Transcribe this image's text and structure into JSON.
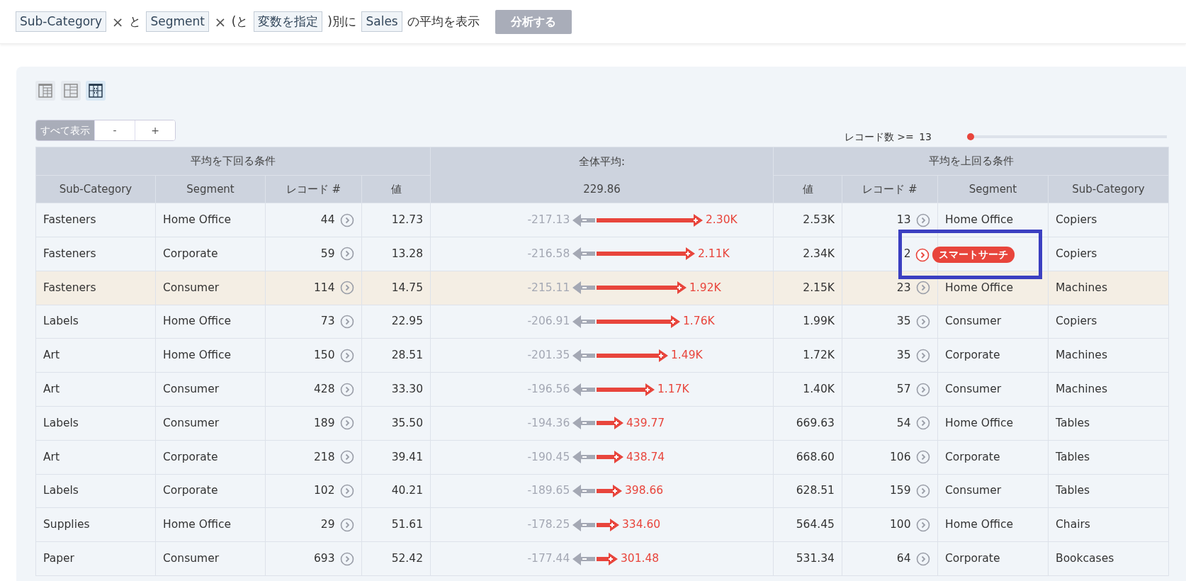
{
  "query_bar": {
    "parts": [
      {
        "kind": "tag",
        "text": "Sub-Category"
      },
      {
        "kind": "remove",
        "text": "×"
      },
      {
        "kind": "text",
        "text": "と"
      },
      {
        "kind": "tag",
        "text": "Segment"
      },
      {
        "kind": "remove",
        "text": "×"
      },
      {
        "kind": "text",
        "text": "(と"
      },
      {
        "kind": "tag",
        "text": "変数を指定"
      },
      {
        "kind": "text",
        "text": ")別に"
      },
      {
        "kind": "tag",
        "text": "Sales"
      },
      {
        "kind": "text",
        "text": "の平均を表示"
      }
    ],
    "button": {
      "label": "分析する",
      "disabled": true
    }
  },
  "view_modes": [
    {
      "kind": "rows",
      "selected": false
    },
    {
      "kind": "grid",
      "selected": false
    },
    {
      "kind": "split",
      "selected": true
    }
  ],
  "zoom_buttons": [
    {
      "label": "すべて表示",
      "selected": true
    },
    {
      "label": "-",
      "selected": false
    },
    {
      "label": "+",
      "selected": false
    }
  ],
  "record_filter": {
    "label": "レコード数 >=",
    "value": "13",
    "level": 0
  },
  "table": {
    "below_header": "平均を下回る条件",
    "overall_label": "全体平均:",
    "overall_value": "229.86",
    "above_header": "平均を上回る条件",
    "left_columns": [
      "Sub-Category",
      "Segment",
      "レコード #",
      "値"
    ],
    "right_columns": [
      "値",
      "レコード #",
      "Segment",
      "Sub-Category"
    ],
    "rows": [
      {
        "left_subcategory": "Fasteners",
        "left_segment": "Home Office",
        "left_records": "44",
        "left_value": "12.73",
        "minus_delta": "-217.13",
        "plus_delta": "2.30K",
        "right_value": "2.53K",
        "right_records": "13",
        "right_segment": "Home Office",
        "right_subcategory": "Copiers",
        "hovered": false
      },
      {
        "left_subcategory": "Fasteners",
        "left_segment": "Corporate",
        "left_records": "59",
        "left_value": "13.28",
        "minus_delta": "-216.58",
        "plus_delta": "2.11K",
        "right_value": "2.34K",
        "right_records": "2",
        "right_subcategory": "Copiers",
        "smart_search": "スマートサーチ",
        "annotated": true,
        "hovered": false
      },
      {
        "left_subcategory": "Fasteners",
        "left_segment": "Consumer",
        "left_records": "114",
        "left_value": "14.75",
        "minus_delta": "-215.11",
        "plus_delta": "1.92K",
        "right_value": "2.15K",
        "right_records": "23",
        "right_segment": "Home Office",
        "right_subcategory": "Machines",
        "hovered": true
      },
      {
        "left_subcategory": "Labels",
        "left_segment": "Home Office",
        "left_records": "73",
        "left_value": "22.95",
        "minus_delta": "-206.91",
        "plus_delta": "1.76K",
        "right_value": "1.99K",
        "right_records": "35",
        "right_segment": "Consumer",
        "right_subcategory": "Copiers",
        "hovered": false
      },
      {
        "left_subcategory": "Art",
        "left_segment": "Home Office",
        "left_records": "150",
        "left_value": "28.51",
        "minus_delta": "-201.35",
        "plus_delta": "1.49K",
        "right_value": "1.72K",
        "right_records": "35",
        "right_segment": "Corporate",
        "right_subcategory": "Machines",
        "hovered": false
      },
      {
        "left_subcategory": "Art",
        "left_segment": "Consumer",
        "left_records": "428",
        "left_value": "33.30",
        "minus_delta": "-196.56",
        "plus_delta": "1.17K",
        "right_value": "1.40K",
        "right_records": "57",
        "right_segment": "Consumer",
        "right_subcategory": "Machines",
        "hovered": false
      },
      {
        "left_subcategory": "Labels",
        "left_segment": "Consumer",
        "left_records": "189",
        "left_value": "35.50",
        "minus_delta": "-194.36",
        "plus_delta": "439.77",
        "right_value": "669.63",
        "right_records": "54",
        "right_segment": "Home Office",
        "right_subcategory": "Tables",
        "hovered": false
      },
      {
        "left_subcategory": "Art",
        "left_segment": "Corporate",
        "left_records": "218",
        "left_value": "39.41",
        "minus_delta": "-190.45",
        "plus_delta": "438.74",
        "right_value": "668.60",
        "right_records": "106",
        "right_segment": "Corporate",
        "right_subcategory": "Tables",
        "hovered": false
      },
      {
        "left_subcategory": "Labels",
        "left_segment": "Corporate",
        "left_records": "102",
        "left_value": "40.21",
        "minus_delta": "-189.65",
        "plus_delta": "398.66",
        "right_value": "628.51",
        "right_records": "159",
        "right_segment": "Consumer",
        "right_subcategory": "Tables",
        "hovered": false
      },
      {
        "left_subcategory": "Supplies",
        "left_segment": "Home Office",
        "left_records": "29",
        "left_value": "51.61",
        "minus_delta": "-178.25",
        "plus_delta": "334.60",
        "right_value": "564.45",
        "right_records": "100",
        "right_segment": "Home Office",
        "right_subcategory": "Chairs",
        "hovered": false
      },
      {
        "left_subcategory": "Paper",
        "left_segment": "Consumer",
        "left_records": "693",
        "left_value": "52.42",
        "minus_delta": "-177.44",
        "plus_delta": "301.48",
        "right_value": "531.34",
        "right_records": "64",
        "right_segment": "Corporate",
        "right_subcategory": "Bookcases",
        "hovered": false
      }
    ]
  }
}
